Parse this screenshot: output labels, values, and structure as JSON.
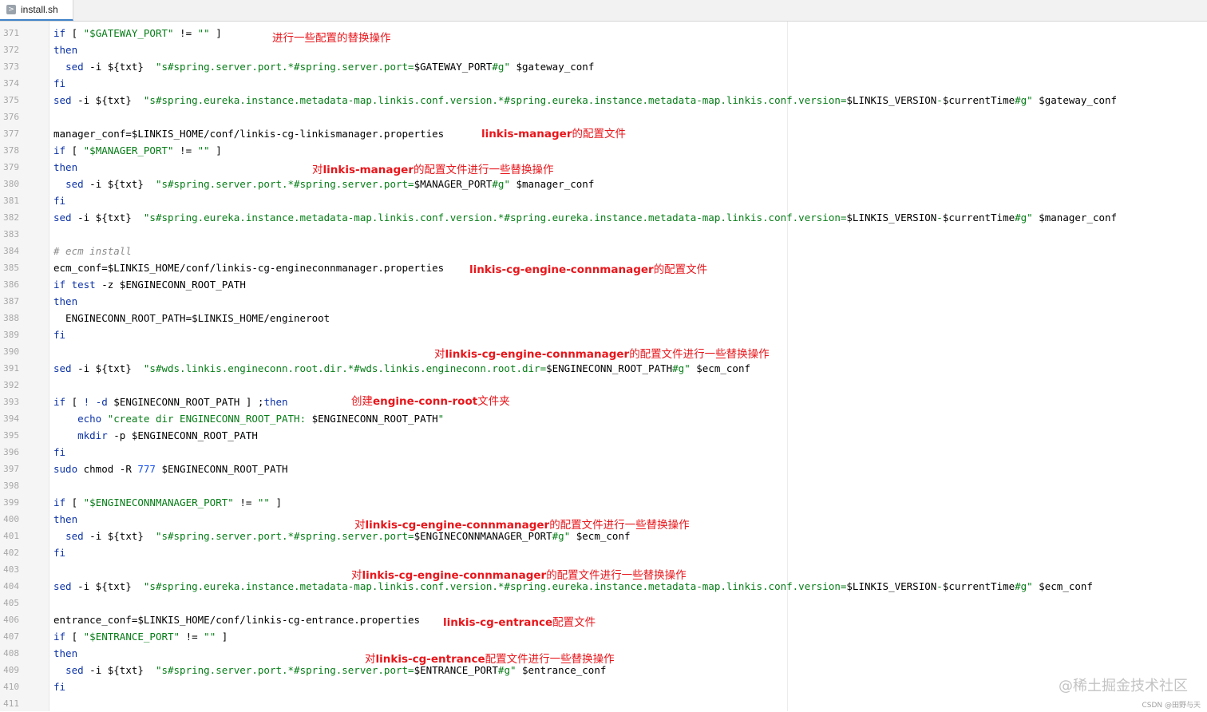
{
  "tab": {
    "label": "install.sh",
    "icon": "shell-file-icon"
  },
  "line_numbers": [
    "371",
    "372",
    "373",
    "374",
    "375",
    "376",
    "377",
    "378",
    "379",
    "380",
    "381",
    "382",
    "383",
    "384",
    "385",
    "386",
    "387",
    "388",
    "389",
    "390",
    "391",
    "392",
    "393",
    "394",
    "395",
    "396",
    "397",
    "398",
    "399",
    "400",
    "401",
    "402",
    "403",
    "404",
    "405",
    "406",
    "407",
    "408",
    "409",
    "410",
    "411"
  ],
  "code": [
    [
      {
        "t": "if",
        "c": "kw"
      },
      {
        "t": " [ "
      },
      {
        "t": "\"$GATEWAY_PORT\"",
        "c": "str"
      },
      {
        "t": " != "
      },
      {
        "t": "\"\"",
        "c": "str"
      },
      {
        "t": " ]"
      }
    ],
    [
      {
        "t": "then",
        "c": "kw"
      }
    ],
    [
      {
        "t": "  "
      },
      {
        "t": "sed",
        "c": "kw"
      },
      {
        "t": " -i ${txt}  "
      },
      {
        "t": "\"s#spring.server.port.*#spring.server.port=",
        "c": "str"
      },
      {
        "t": "$GATEWAY_PORT"
      },
      {
        "t": "#g\"",
        "c": "str"
      },
      {
        "t": " $gateway_conf"
      }
    ],
    [
      {
        "t": "fi",
        "c": "kw"
      }
    ],
    [
      {
        "t": "sed",
        "c": "kw"
      },
      {
        "t": " -i ${txt}  "
      },
      {
        "t": "\"s#spring.eureka.instance.metadata-map.linkis.conf.version.*#spring.eureka.instance.metadata-map.linkis.conf.version=",
        "c": "str"
      },
      {
        "t": "$LINKIS_VERSION"
      },
      {
        "t": "-",
        "c": "str"
      },
      {
        "t": "$currentTime"
      },
      {
        "t": "#g\"",
        "c": "str"
      },
      {
        "t": " $gateway_conf"
      }
    ],
    [],
    [
      {
        "t": "manager_conf=$LINKIS_HOME/conf/linkis-cg-linkismanager.properties"
      }
    ],
    [
      {
        "t": "if",
        "c": "kw"
      },
      {
        "t": " [ "
      },
      {
        "t": "\"$MANAGER_PORT\"",
        "c": "str"
      },
      {
        "t": " != "
      },
      {
        "t": "\"\"",
        "c": "str"
      },
      {
        "t": " ]"
      }
    ],
    [
      {
        "t": "then",
        "c": "kw"
      }
    ],
    [
      {
        "t": "  "
      },
      {
        "t": "sed",
        "c": "kw"
      },
      {
        "t": " -i ${txt}  "
      },
      {
        "t": "\"s#spring.server.port.*#spring.server.port=",
        "c": "str"
      },
      {
        "t": "$MANAGER_PORT"
      },
      {
        "t": "#g\"",
        "c": "str"
      },
      {
        "t": " $manager_conf"
      }
    ],
    [
      {
        "t": "fi",
        "c": "kw"
      }
    ],
    [
      {
        "t": "sed",
        "c": "kw"
      },
      {
        "t": " -i ${txt}  "
      },
      {
        "t": "\"s#spring.eureka.instance.metadata-map.linkis.conf.version.*#spring.eureka.instance.metadata-map.linkis.conf.version=",
        "c": "str"
      },
      {
        "t": "$LINKIS_VERSION"
      },
      {
        "t": "-",
        "c": "str"
      },
      {
        "t": "$currentTime"
      },
      {
        "t": "#g\"",
        "c": "str"
      },
      {
        "t": " $manager_conf"
      }
    ],
    [],
    [
      {
        "t": "# ecm install",
        "c": "cmt"
      }
    ],
    [
      {
        "t": "ecm_conf=$LINKIS_HOME/conf/linkis-cg-engineconnmanager.properties"
      }
    ],
    [
      {
        "t": "if",
        "c": "kw"
      },
      {
        "t": " "
      },
      {
        "t": "test",
        "c": "kw"
      },
      {
        "t": " -z $ENGINECONN_ROOT_PATH"
      }
    ],
    [
      {
        "t": "then",
        "c": "kw"
      }
    ],
    [
      {
        "t": "  ENGINECONN_ROOT_PATH=$LINKIS_HOME/engineroot"
      }
    ],
    [
      {
        "t": "fi",
        "c": "kw"
      }
    ],
    [],
    [
      {
        "t": "sed",
        "c": "kw"
      },
      {
        "t": " -i ${txt}  "
      },
      {
        "t": "\"s#wds.linkis.engineconn.root.dir.*#wds.linkis.engineconn.root.dir=",
        "c": "str"
      },
      {
        "t": "$ENGINECONN_ROOT_PATH"
      },
      {
        "t": "#g\"",
        "c": "str"
      },
      {
        "t": " $ecm_conf"
      }
    ],
    [],
    [
      {
        "t": "if",
        "c": "kw"
      },
      {
        "t": " [ "
      },
      {
        "t": "!",
        "c": "kw"
      },
      {
        "t": " "
      },
      {
        "t": "-d",
        "c": "kw"
      },
      {
        "t": " $ENGINECONN_ROOT_PATH ] ;"
      },
      {
        "t": "then",
        "c": "kw"
      }
    ],
    [
      {
        "t": "    "
      },
      {
        "t": "echo",
        "c": "kw"
      },
      {
        "t": " "
      },
      {
        "t": "\"create dir ENGINECONN_ROOT_PATH: ",
        "c": "str"
      },
      {
        "t": "$ENGINECONN_ROOT_PATH"
      },
      {
        "t": "\"",
        "c": "str"
      }
    ],
    [
      {
        "t": "    "
      },
      {
        "t": "mkdir",
        "c": "kw"
      },
      {
        "t": " -p $ENGINECONN_ROOT_PATH"
      }
    ],
    [
      {
        "t": "fi",
        "c": "kw"
      }
    ],
    [
      {
        "t": "sudo",
        "c": "kw"
      },
      {
        "t": " chmod -R "
      },
      {
        "t": "777",
        "c": "num"
      },
      {
        "t": " $ENGINECONN_ROOT_PATH"
      }
    ],
    [],
    [
      {
        "t": "if",
        "c": "kw"
      },
      {
        "t": " [ "
      },
      {
        "t": "\"$ENGINECONNMANAGER_PORT\"",
        "c": "str"
      },
      {
        "t": " != "
      },
      {
        "t": "\"\"",
        "c": "str"
      },
      {
        "t": " ]"
      }
    ],
    [
      {
        "t": "then",
        "c": "kw"
      }
    ],
    [
      {
        "t": "  "
      },
      {
        "t": "sed",
        "c": "kw"
      },
      {
        "t": " -i ${txt}  "
      },
      {
        "t": "\"s#spring.server.port.*#spring.server.port=",
        "c": "str"
      },
      {
        "t": "$ENGINECONNMANAGER_PORT"
      },
      {
        "t": "#g\"",
        "c": "str"
      },
      {
        "t": " $ecm_conf"
      }
    ],
    [
      {
        "t": "fi",
        "c": "kw"
      }
    ],
    [],
    [
      {
        "t": "sed",
        "c": "kw"
      },
      {
        "t": " -i ${txt}  "
      },
      {
        "t": "\"s#spring.eureka.instance.metadata-map.linkis.conf.version.*#spring.eureka.instance.metadata-map.linkis.conf.version=",
        "c": "str"
      },
      {
        "t": "$LINKIS_VERSION"
      },
      {
        "t": "-",
        "c": "str"
      },
      {
        "t": "$currentTime"
      },
      {
        "t": "#g\"",
        "c": "str"
      },
      {
        "t": " $ecm_conf"
      }
    ],
    [],
    [
      {
        "t": "entrance_conf=$LINKIS_HOME/conf/linkis-cg-entrance.properties"
      }
    ],
    [
      {
        "t": "if",
        "c": "kw"
      },
      {
        "t": " [ "
      },
      {
        "t": "\"$ENTRANCE_PORT\"",
        "c": "str"
      },
      {
        "t": " != "
      },
      {
        "t": "\"\"",
        "c": "str"
      },
      {
        "t": " ]"
      }
    ],
    [
      {
        "t": "then",
        "c": "kw"
      }
    ],
    [
      {
        "t": "  "
      },
      {
        "t": "sed",
        "c": "kw"
      },
      {
        "t": " -i ${txt}  "
      },
      {
        "t": "\"s#spring.server.port.*#spring.server.port=",
        "c": "str"
      },
      {
        "t": "$ENTRANCE_PORT"
      },
      {
        "t": "#g\"",
        "c": "str"
      },
      {
        "t": " $entrance_conf"
      }
    ],
    [
      {
        "t": "fi",
        "c": "kw"
      }
    ],
    []
  ],
  "annotations": {
    "gateway": [
      {
        "t": "进行一些配置的替换操作"
      }
    ],
    "manager_file": [
      {
        "t": "linkis-manager",
        "b": true
      },
      {
        "t": "的配置文件"
      }
    ],
    "manager_replace": [
      {
        "t": "对"
      },
      {
        "t": "linkis-manager",
        "b": true
      },
      {
        "t": "的配置文件进行一些替换操作"
      }
    ],
    "ecm_file": [
      {
        "t": "linkis-cg-engine-connmanager",
        "b": true
      },
      {
        "t": "的配置文件"
      }
    ],
    "ecm_replace_1": [
      {
        "t": "对"
      },
      {
        "t": "linkis-cg-engine-connmanager",
        "b": true
      },
      {
        "t": "的配置文件进行一些替换操作"
      }
    ],
    "ecm_mkdir": [
      {
        "t": "创建"
      },
      {
        "t": "engine-conn-root",
        "b": true
      },
      {
        "t": "文件夹"
      }
    ],
    "ecm_replace_2": [
      {
        "t": "对"
      },
      {
        "t": "linkis-cg-engine-connmanager",
        "b": true
      },
      {
        "t": "的配置文件进行一些替换操作"
      }
    ],
    "ecm_replace_3": [
      {
        "t": "对"
      },
      {
        "t": "linkis-cg-engine-connmanager",
        "b": true
      },
      {
        "t": "的配置文件进行一些替换操作"
      }
    ],
    "entrance_file": [
      {
        "t": "linkis-cg-entrance",
        "b": true
      },
      {
        "t": "配置文件"
      }
    ],
    "entrance_replace": [
      {
        "t": "对"
      },
      {
        "t": "linkis-cg-entrance",
        "b": true
      },
      {
        "t": "配置文件进行一些替换操作"
      }
    ]
  },
  "watermark": "@稀土掘金技术社区",
  "csdn_mark": "CSDN @田野与天"
}
